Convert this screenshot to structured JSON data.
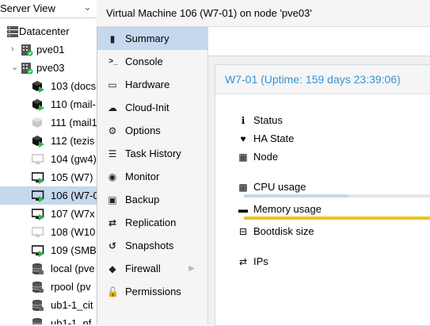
{
  "sidebar": {
    "view_label": "Server View",
    "tree": [
      {
        "label": "Datacenter",
        "icon": "datacenter-icon",
        "type": "datacenter",
        "level": 0,
        "expanded": true
      },
      {
        "label": "pve01",
        "icon": "node-icon",
        "type": "node",
        "level": 1,
        "expanded": false
      },
      {
        "label": "pve03",
        "icon": "node-icon",
        "type": "node",
        "level": 1,
        "expanded": true
      },
      {
        "label": "103 (docs",
        "icon": "container-running-icon",
        "type": "ct",
        "status": "running",
        "level": 2
      },
      {
        "label": "110 (mail-",
        "icon": "container-running-icon",
        "type": "ct",
        "status": "running",
        "level": 2
      },
      {
        "label": "111 (mail1",
        "icon": "container-stopped-icon",
        "type": "ct",
        "status": "stopped",
        "level": 2
      },
      {
        "label": "112 (tezis",
        "icon": "container-running-icon",
        "type": "ct",
        "status": "running",
        "level": 2
      },
      {
        "label": "104 (gw4)",
        "icon": "vm-stopped-icon",
        "type": "vm",
        "status": "stopped",
        "level": 2
      },
      {
        "label": "105 (W7)",
        "icon": "vm-running-icon",
        "type": "vm",
        "status": "running",
        "level": 2
      },
      {
        "label": "106 (W7-0",
        "icon": "vm-running-icon",
        "type": "vm",
        "status": "running",
        "level": 2,
        "selected": true
      },
      {
        "label": "107 (W7x",
        "icon": "vm-running-icon",
        "type": "vm",
        "status": "running",
        "level": 2
      },
      {
        "label": "108 (W10",
        "icon": "vm-stopped-icon",
        "type": "vm",
        "status": "stopped",
        "level": 2
      },
      {
        "label": "109 (SMB",
        "icon": "vm-running-icon",
        "type": "vm",
        "status": "running",
        "level": 2
      },
      {
        "label": "local (pve",
        "icon": "storage-icon",
        "type": "storage",
        "level": 2
      },
      {
        "label": "rpool (pv",
        "icon": "storage-icon",
        "type": "storage",
        "level": 2
      },
      {
        "label": "ub1-1_cit",
        "icon": "storage-icon",
        "type": "storage",
        "level": 2
      },
      {
        "label": "ub1-1_nf",
        "icon": "storage-icon",
        "type": "storage",
        "level": 2
      }
    ]
  },
  "header": {
    "title": "Virtual Machine 106 (W7-01) on node 'pve03'"
  },
  "nav": [
    {
      "label": "Summary",
      "icon": "book-icon",
      "glyph": "▮",
      "active": true
    },
    {
      "label": "Console",
      "icon": "terminal-icon",
      "glyph": ">_"
    },
    {
      "label": "Hardware",
      "icon": "monitor-icon",
      "glyph": "▭"
    },
    {
      "label": "Cloud-Init",
      "icon": "cloud-icon",
      "glyph": "☁"
    },
    {
      "label": "Options",
      "icon": "gear-icon",
      "glyph": "⚙"
    },
    {
      "label": "Task History",
      "icon": "list-icon",
      "glyph": "☰"
    },
    {
      "label": "Monitor",
      "icon": "eye-icon",
      "glyph": "◉"
    },
    {
      "label": "Backup",
      "icon": "floppy-icon",
      "glyph": "▣"
    },
    {
      "label": "Replication",
      "icon": "retweet-icon",
      "glyph": "⇄"
    },
    {
      "label": "Snapshots",
      "icon": "history-icon",
      "glyph": "↺"
    },
    {
      "label": "Firewall",
      "icon": "shield-icon",
      "glyph": "◆",
      "has_submenu": true
    },
    {
      "label": "Permissions",
      "icon": "unlock-icon",
      "glyph": "🔓"
    }
  ],
  "summary": {
    "title": "W7-01 (Uptime: 159 days 23:39:06)",
    "rows": [
      {
        "label": "Status",
        "icon": "info-icon",
        "glyph": "ℹ"
      },
      {
        "label": "HA State",
        "icon": "heartbeat-icon",
        "glyph": "♥"
      },
      {
        "label": "Node",
        "icon": "building-icon",
        "glyph": "▦"
      },
      {
        "label": "CPU usage",
        "icon": "cpu-icon",
        "glyph": "▩"
      },
      {
        "label": "Memory usage",
        "icon": "memory-icon",
        "glyph": "▬"
      },
      {
        "label": "Bootdisk size",
        "icon": "hdd-icon",
        "glyph": "⊟"
      },
      {
        "label": "IPs",
        "icon": "exchange-icon",
        "glyph": "⇄"
      }
    ],
    "cpu_usage_fraction": 0.54,
    "memory_usage_fraction": 1.0,
    "colors": {
      "cpu_bar": "#c5d8ee",
      "memory_bar": "#f0c419",
      "accent": "#3892d4",
      "running": "#21bf4b"
    }
  }
}
